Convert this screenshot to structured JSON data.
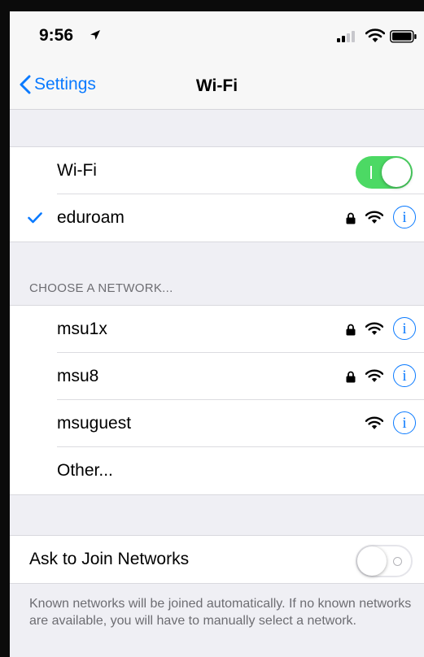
{
  "status_bar": {
    "time": "9:56"
  },
  "nav": {
    "back_label": "Settings",
    "title": "Wi-Fi"
  },
  "wifi_toggle": {
    "label": "Wi-Fi",
    "state": "on"
  },
  "connected_network": {
    "name": "eduroam",
    "secured": true
  },
  "choose_header": "CHOOSE A NETWORK...",
  "networks": [
    {
      "name": "msu1x",
      "secured": true
    },
    {
      "name": "msu8",
      "secured": true
    },
    {
      "name": "msuguest",
      "secured": false
    }
  ],
  "other_label": "Other...",
  "ask_to_join": {
    "label": "Ask to Join Networks",
    "state": "off"
  },
  "footer": "Known networks will be joined automatically. If no known networks are available, you will have to manually select a network.",
  "info_glyph": "i",
  "colors": {
    "accent": "#0a7aff",
    "toggle_on": "#4cd964",
    "background": "#efeff4"
  }
}
